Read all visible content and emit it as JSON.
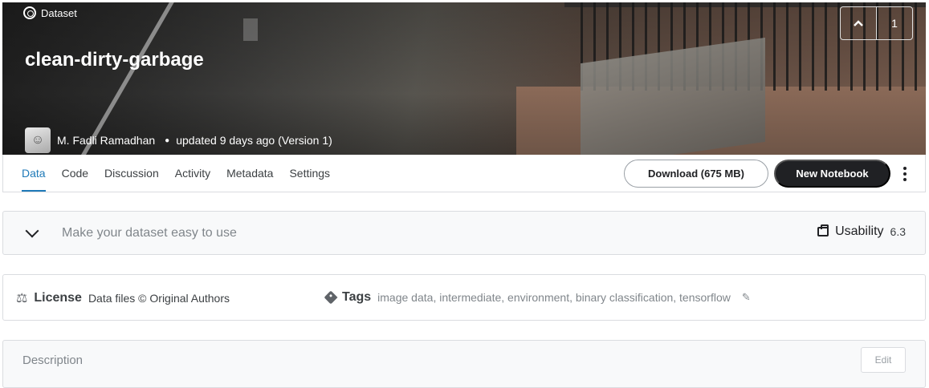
{
  "header": {
    "kind_label": "Dataset",
    "title": "clean-dirty-garbage",
    "author": "M. Fadli Ramadhan",
    "updated": "updated 9 days ago (Version 1)",
    "upvote_count": "1"
  },
  "tabs": [
    {
      "label": "Data",
      "active": true
    },
    {
      "label": "Code"
    },
    {
      "label": "Discussion"
    },
    {
      "label": "Activity"
    },
    {
      "label": "Metadata"
    },
    {
      "label": "Settings"
    }
  ],
  "actions": {
    "download_label": "Download (675 MB)",
    "new_notebook_label": "New Notebook"
  },
  "usability": {
    "prompt": "Make your dataset easy to use",
    "label": "Usability",
    "score": "6.3"
  },
  "license": {
    "label": "License",
    "value": "Data files © Original Authors"
  },
  "tags": {
    "label": "Tags",
    "items": [
      "image data",
      "intermediate",
      "environment",
      "binary classification",
      "tensorflow"
    ]
  },
  "description": {
    "label": "Description",
    "edit_label": "Edit"
  }
}
